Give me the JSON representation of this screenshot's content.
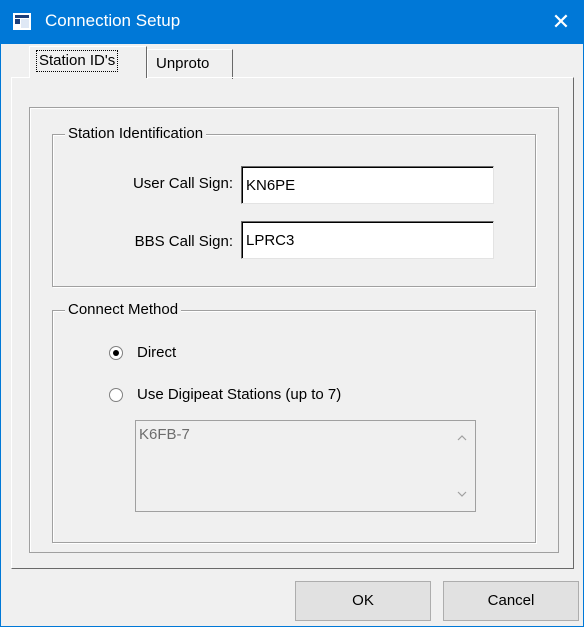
{
  "window": {
    "title": "Connection Setup",
    "close_glyph": "✕"
  },
  "tabs": [
    {
      "label": "Station ID's",
      "active": true
    },
    {
      "label": "Unproto",
      "active": false
    }
  ],
  "station_identification": {
    "group_label": "Station Identification",
    "user_call_sign": {
      "label": "User Call Sign:",
      "value": "KN6PE"
    },
    "bbs_call_sign": {
      "label": "BBS Call Sign:",
      "value": "LPRC3"
    }
  },
  "connect_method": {
    "group_label": "Connect Method",
    "options": [
      {
        "label": "Direct",
        "selected": true
      },
      {
        "label": "Use Digipeat Stations (up to 7)",
        "selected": false
      }
    ],
    "digipeat_list": [
      "K6FB-7"
    ]
  },
  "buttons": {
    "ok": "OK",
    "cancel": "Cancel"
  },
  "colors": {
    "titlebar": "#0078d7",
    "face": "#f0f0f0"
  },
  "icons": {
    "app": "window-app-icon",
    "close": "close-icon",
    "scroll_up": "scroll-up-arrow-icon",
    "scroll_down": "scroll-down-arrow-icon"
  }
}
